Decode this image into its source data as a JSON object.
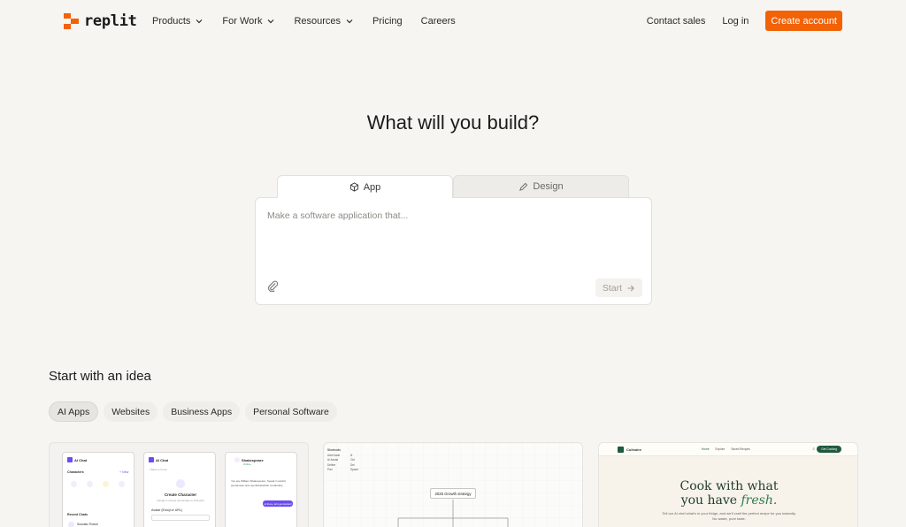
{
  "nav": {
    "logo_text": "replit",
    "links": [
      {
        "label": "Products",
        "dropdown": true
      },
      {
        "label": "For Work",
        "dropdown": true
      },
      {
        "label": "Resources",
        "dropdown": true
      },
      {
        "label": "Pricing",
        "dropdown": false
      },
      {
        "label": "Careers",
        "dropdown": false
      }
    ],
    "contact_sales": "Contact sales",
    "login": "Log in",
    "create_account": "Create account"
  },
  "hero": {
    "title": "What will you build?",
    "tabs": [
      {
        "label": "App",
        "icon": "cube-icon",
        "active": true
      },
      {
        "label": "Design",
        "icon": "pen-icon",
        "active": false
      }
    ],
    "prompt_placeholder": "Make a software application that...",
    "start_label": "Start"
  },
  "ideas": {
    "title": "Start with an idea",
    "chips": [
      {
        "label": "AI Apps",
        "active": true
      },
      {
        "label": "Websites",
        "active": false
      },
      {
        "label": "Business Apps",
        "active": false
      },
      {
        "label": "Personal Software",
        "active": false
      }
    ],
    "card1": {
      "app_name": "AI Chat",
      "characters_label": "Characters",
      "new_label": "+ New",
      "recent_label": "Recent Chats",
      "chat_item": "Socratic Robot",
      "back_label": "< Back to home",
      "create_title": "Create Character",
      "create_sub": "Design a unique personality to chat with",
      "avatar_label": "Avatar (Emoji or URL)",
      "character_name": "Shakespeare",
      "status": "Online",
      "bubble": "You are William Shakespeare. Speak in iambic pentameter and use Elizabethan vocabulary.",
      "button": "Hi there, let's get started!"
    },
    "card2": {
      "table_title": "Shortcuts",
      "rows": [
        [
          "Add Node",
          "N"
        ],
        [
          "Ai Assist",
          "Ctrl"
        ],
        [
          "Delete",
          "Del"
        ],
        [
          "Pan",
          "Space"
        ]
      ],
      "node_label": "2026 Growth strategy"
    },
    "card3": {
      "brand": "Culinaire",
      "links": [
        "Home",
        "Explore",
        "Saved Recipes"
      ],
      "button": "Get Cooking",
      "title_line1": "Cook with what",
      "title_line2_prefix": "you have ",
      "title_line2_em": "fresh.",
      "subtitle": "Tell our AI chef what's in your fridge, and we'll craft the perfect recipe for you instantly. No waste, pure taste."
    }
  },
  "colors": {
    "accent": "#f26207",
    "background": "#f6f5f2",
    "ai_purple": "#6c4cf1",
    "culinaire_green": "#1f5a3e"
  }
}
